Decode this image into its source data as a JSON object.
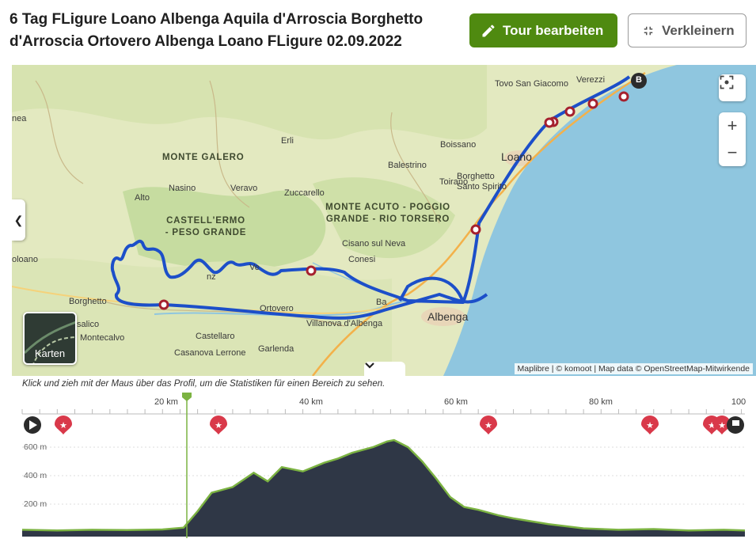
{
  "header": {
    "title": "6 Tag FLigure Loano Albenga Aquila d'Arroscia Borghetto d'Arroscia Ortovero Albenga Loano FLigure 02.09.2022",
    "edit_button": "Tour bearbeiten",
    "shrink_button": "Verkleinern",
    "edit_icon": "pencil-icon",
    "shrink_icon": "collapse-arrows-icon"
  },
  "map": {
    "places": [
      {
        "id": "tovo",
        "text": "Tovo San Giacomo"
      },
      {
        "id": "verezzi",
        "text": "Verezzi"
      },
      {
        "id": "nea",
        "text": "nea"
      },
      {
        "id": "erli",
        "text": "Erli"
      },
      {
        "id": "boissano",
        "text": "Boissano"
      },
      {
        "id": "balestrino",
        "text": "Balestrino"
      },
      {
        "id": "toirano",
        "text": "Toirano"
      },
      {
        "id": "loano",
        "text": "Loano"
      },
      {
        "id": "nasino",
        "text": "Nasino"
      },
      {
        "id": "veravo",
        "text": "Veravo"
      },
      {
        "id": "zuccarello",
        "text": "Zuccarello"
      },
      {
        "id": "borghetto_ss",
        "text": "Borghetto Santo Spirito"
      },
      {
        "id": "alto",
        "text": "Alto"
      },
      {
        "id": "cisano",
        "text": "Cisano sul Neva"
      },
      {
        "id": "oloano",
        "text": "oloano"
      },
      {
        "id": "conesi",
        "text": "Conesi"
      },
      {
        "id": "borghetto",
        "text": "Borghetto"
      },
      {
        "id": "ortovero",
        "text": "Ortovero"
      },
      {
        "id": "salico",
        "text": "salico"
      },
      {
        "id": "villanova",
        "text": "Villanova d'Albenga"
      },
      {
        "id": "albenga",
        "text": "Albenga"
      },
      {
        "id": "montecalvo",
        "text": "Montecalvo"
      },
      {
        "id": "castellaro",
        "text": "Castellaro"
      },
      {
        "id": "garlenda",
        "text": "Garlenda"
      },
      {
        "id": "casanova",
        "text": "Casanova Lerrone"
      },
      {
        "id": "ba",
        "text": "Ba"
      },
      {
        "id": "ve",
        "text": "Ve"
      },
      {
        "id": "nz",
        "text": "nz"
      }
    ],
    "regions": [
      {
        "id": "galero",
        "text": "MONTE GALERO"
      },
      {
        "id": "castellermo",
        "text": "CASTELL'ERMO\n- PESO GRANDE"
      },
      {
        "id": "acuto",
        "text": "MONTE ACUTO - POGGIO\nGRANDE - RIO TORSERO"
      }
    ],
    "end_marker": "B",
    "layer_button": "Karten",
    "attribution": "Maplibre | © komoot | Map data © OpenStreetMap-Mitwirkende",
    "route_color": "#1c4fc9",
    "sea_color": "#8fc6df"
  },
  "profile": {
    "hint": "Klick und zieh mit der Maus über das Profil, um die Statistiken für einen Bereich zu sehen.",
    "km_ticks": [
      "20 km",
      "40 km",
      "60 km",
      "80 km",
      "100"
    ],
    "alt_ticks": [
      "600 m",
      "400 m",
      "200 m"
    ],
    "fill_color": "#2f3746",
    "line_color": "#7cb342",
    "elevation": {
      "km": [
        0,
        5,
        10,
        15,
        20,
        23,
        25,
        27,
        30,
        33,
        35,
        37,
        40,
        43,
        45,
        47,
        50,
        52,
        53,
        55,
        57,
        59,
        61,
        63,
        65,
        68,
        70,
        75,
        80,
        85,
        90,
        95,
        100,
        103
      ],
      "m": [
        20,
        15,
        20,
        18,
        22,
        35,
        150,
        280,
        320,
        420,
        360,
        460,
        430,
        490,
        520,
        560,
        600,
        640,
        650,
        600,
        500,
        380,
        250,
        180,
        160,
        120,
        100,
        60,
        30,
        20,
        25,
        15,
        20,
        15
      ]
    }
  }
}
